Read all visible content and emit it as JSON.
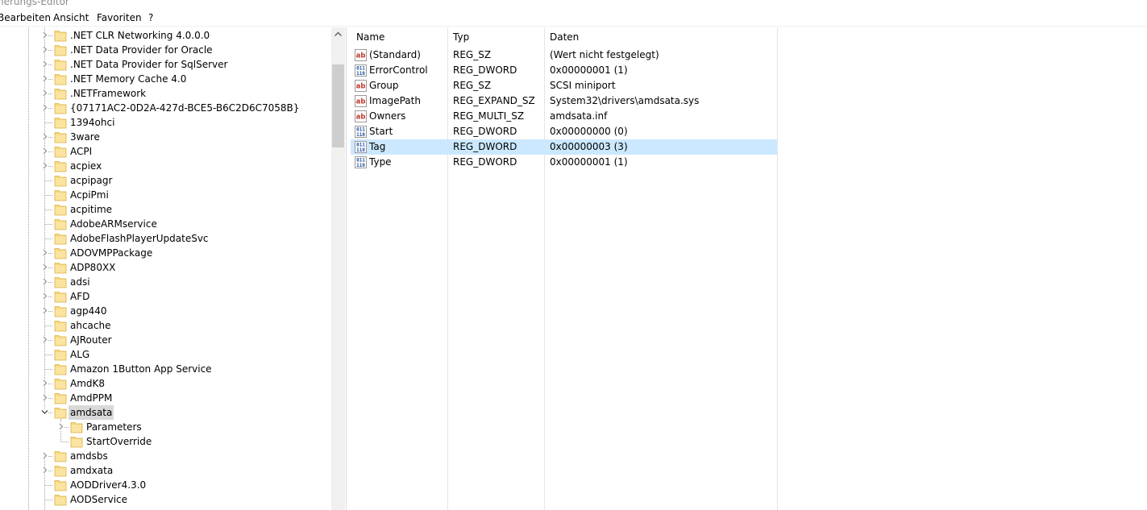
{
  "window": {
    "title": "nerungs-Editor"
  },
  "menu": [
    "Bearbeiten",
    "Ansicht",
    "Favoriten",
    "?"
  ],
  "tree": [
    {
      "label": ".NET CLR Networking 4.0.0.0",
      "expandable": true
    },
    {
      "label": ".NET Data Provider for Oracle",
      "expandable": true
    },
    {
      "label": ".NET Data Provider for SqlServer",
      "expandable": true
    },
    {
      "label": ".NET Memory Cache 4.0",
      "expandable": true
    },
    {
      "label": ".NETFramework",
      "expandable": true
    },
    {
      "label": "{07171AC2-0D2A-427d-BCE5-B6C2D6C7058B}",
      "expandable": true
    },
    {
      "label": "1394ohci",
      "expandable": false
    },
    {
      "label": "3ware",
      "expandable": true
    },
    {
      "label": "ACPI",
      "expandable": true
    },
    {
      "label": "acpiex",
      "expandable": true
    },
    {
      "label": "acpipagr",
      "expandable": false
    },
    {
      "label": "AcpiPmi",
      "expandable": false
    },
    {
      "label": "acpitime",
      "expandable": false
    },
    {
      "label": "AdobeARMservice",
      "expandable": false
    },
    {
      "label": "AdobeFlashPlayerUpdateSvc",
      "expandable": false
    },
    {
      "label": "ADOVMPPackage",
      "expandable": true
    },
    {
      "label": "ADP80XX",
      "expandable": true
    },
    {
      "label": "adsi",
      "expandable": true
    },
    {
      "label": "AFD",
      "expandable": true
    },
    {
      "label": "agp440",
      "expandable": true
    },
    {
      "label": "ahcache",
      "expandable": false
    },
    {
      "label": "AJRouter",
      "expandable": true
    },
    {
      "label": "ALG",
      "expandable": false
    },
    {
      "label": "Amazon 1Button App Service",
      "expandable": false
    },
    {
      "label": "AmdK8",
      "expandable": true
    },
    {
      "label": "AmdPPM",
      "expandable": true
    },
    {
      "label": "amdsata",
      "expandable": true,
      "expanded": true,
      "selected": true
    },
    {
      "label": "Parameters",
      "expandable": true,
      "child": true
    },
    {
      "label": "StartOverride",
      "expandable": false,
      "child": true
    },
    {
      "label": "amdsbs",
      "expandable": true
    },
    {
      "label": "amdxata",
      "expandable": true
    },
    {
      "label": "AODDriver4.3.0",
      "expandable": false
    },
    {
      "label": "AODService",
      "expandable": false
    }
  ],
  "values": {
    "columns": [
      "Name",
      "Typ",
      "Daten"
    ],
    "rows": [
      {
        "icon": "string",
        "name": "(Standard)",
        "type": "REG_SZ",
        "data": "(Wert nicht festgelegt)"
      },
      {
        "icon": "binary",
        "name": "ErrorControl",
        "type": "REG_DWORD",
        "data": "0x00000001 (1)"
      },
      {
        "icon": "string",
        "name": "Group",
        "type": "REG_SZ",
        "data": "SCSI miniport"
      },
      {
        "icon": "string",
        "name": "ImagePath",
        "type": "REG_EXPAND_SZ",
        "data": "System32\\drivers\\amdsata.sys"
      },
      {
        "icon": "string",
        "name": "Owners",
        "type": "REG_MULTI_SZ",
        "data": "amdsata.inf"
      },
      {
        "icon": "binary",
        "name": "Start",
        "type": "REG_DWORD",
        "data": "0x00000000 (0)"
      },
      {
        "icon": "binary",
        "name": "Tag",
        "type": "REG_DWORD",
        "data": "0x00000003 (3)",
        "selected": true
      },
      {
        "icon": "binary",
        "name": "Type",
        "type": "REG_DWORD",
        "data": "0x00000001 (1)"
      }
    ]
  },
  "icon_names": {
    "string": "ab-string-icon",
    "binary": "binary-value-icon",
    "folder": "folder-icon"
  },
  "colors": {
    "selection": "#cce8ff",
    "tree_selection": "#d9d9d9",
    "folder": "#f8d775"
  }
}
